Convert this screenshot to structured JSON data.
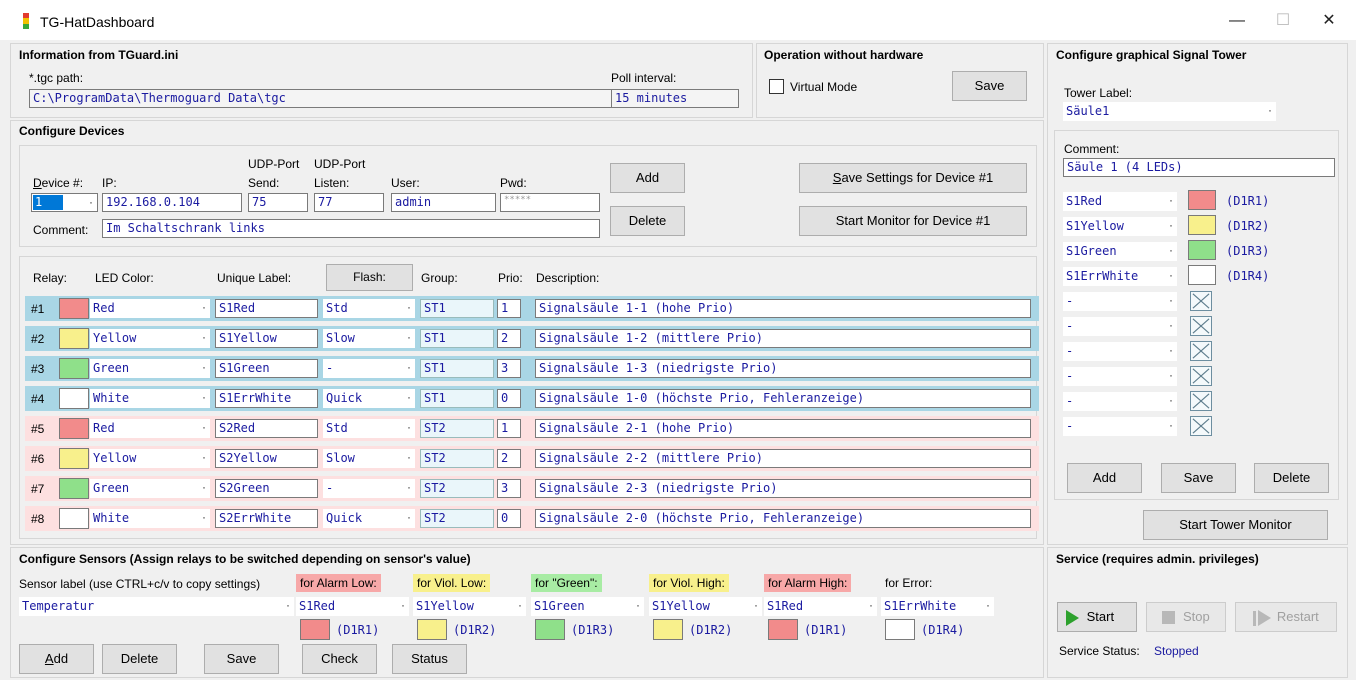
{
  "window": {
    "title": "TG-HatDashboard",
    "minimize": "—",
    "maximize": "☐",
    "close": "✕"
  },
  "info": {
    "title": "Information from TGuard.ini",
    "tgc_label": "*.tgc path:",
    "tgc_value": "C:\\ProgramData\\Thermoguard Data\\tgc",
    "poll_label": "Poll interval:",
    "poll_value": "15 minutes"
  },
  "operation": {
    "title": "Operation without hardware",
    "virtual_label": "Virtual Mode",
    "save": "Save"
  },
  "devices": {
    "title": "Configure Devices",
    "udp_header1": "UDP-Port",
    "udp_header2": "UDP-Port",
    "device_label": "Device #:",
    "device_value": "1",
    "ip_label": "IP:",
    "ip_value": "192.168.0.104",
    "send_label": "Send:",
    "send_value": "75",
    "listen_label": "Listen:",
    "listen_value": "77",
    "user_label": "User:",
    "user_value": "admin",
    "pwd_label": "Pwd:",
    "pwd_value": "*****",
    "comment_label": "Comment:",
    "comment_value": "Im Schaltschrank links",
    "add": "Add",
    "delete": "Delete",
    "save_settings": "Save Settings for Device #1",
    "start_monitor": "Start Monitor for Device #1"
  },
  "relays": {
    "headers": {
      "relay": "Relay:",
      "led": "LED Color:",
      "label": "Unique Label:",
      "flash": "Flash:",
      "group": "Group:",
      "prio": "Prio:",
      "desc": "Description:"
    },
    "rows": [
      {
        "num": "#1",
        "color": "Red",
        "swatch": "#f28b8b",
        "label": "S1Red",
        "flash": "Std",
        "group": "ST1",
        "prio": "1",
        "desc": "Signalsäule 1-1 (hohe Prio)",
        "bg": "#a9d6e5"
      },
      {
        "num": "#2",
        "color": "Yellow",
        "swatch": "#f8f08c",
        "label": "S1Yellow",
        "flash": "Slow",
        "group": "ST1",
        "prio": "2",
        "desc": "Signalsäule 1-2 (mittlere Prio)",
        "bg": "#a9d6e5"
      },
      {
        "num": "#3",
        "color": "Green",
        "swatch": "#8fe08a",
        "label": "S1Green",
        "flash": "-",
        "group": "ST1",
        "prio": "3",
        "desc": "Signalsäule 1-3 (niedrigste Prio)",
        "bg": "#a9d6e5"
      },
      {
        "num": "#4",
        "color": "White",
        "swatch": "#ffffff",
        "label": "S1ErrWhite",
        "flash": "Quick",
        "group": "ST1",
        "prio": "0",
        "desc": "Signalsäule 1-0 (höchste Prio, Fehleranzeige)",
        "bg": "#a9d6e5"
      },
      {
        "num": "#5",
        "color": "Red",
        "swatch": "#f28b8b",
        "label": "S2Red",
        "flash": "Std",
        "group": "ST2",
        "prio": "1",
        "desc": "Signalsäule 2-1 (hohe Prio)",
        "bg": "#fde0e0"
      },
      {
        "num": "#6",
        "color": "Yellow",
        "swatch": "#f8f08c",
        "label": "S2Yellow",
        "flash": "Slow",
        "group": "ST2",
        "prio": "2",
        "desc": "Signalsäule 2-2 (mittlere Prio)",
        "bg": "#fde0e0"
      },
      {
        "num": "#7",
        "color": "Green",
        "swatch": "#8fe08a",
        "label": "S2Green",
        "flash": "-",
        "group": "ST2",
        "prio": "3",
        "desc": "Signalsäule 2-3 (niedrigste Prio)",
        "bg": "#fde0e0"
      },
      {
        "num": "#8",
        "color": "White",
        "swatch": "#ffffff",
        "label": "S2ErrWhite",
        "flash": "Quick",
        "group": "ST2",
        "prio": "0",
        "desc": "Signalsäule 2-0 (höchste Prio, Fehleranzeige)",
        "bg": "#fde0e0"
      }
    ]
  },
  "sensors": {
    "title": "Configure Sensors (Assign relays to be switched depending on sensor's value)",
    "label_header": "Sensor label (use CTRL+c/v to copy settings)",
    "sensor_value": "Temperatur",
    "cols": [
      {
        "header": "for Alarm Low:",
        "bg": "#f7a8a8",
        "value": "S1Red",
        "swatch": "#f28b8b",
        "code": "(D1R1)"
      },
      {
        "header": "for Viol. Low:",
        "bg": "#f8f08c",
        "value": "S1Yellow",
        "swatch": "#f8f08c",
        "code": "(D1R2)"
      },
      {
        "header": "for \"Green\":",
        "bg": "#a8eca4",
        "value": "S1Green",
        "swatch": "#8fe08a",
        "code": "(D1R3)"
      },
      {
        "header": "for Viol. High:",
        "bg": "#f8f08c",
        "value": "S1Yellow",
        "swatch": "#f8f08c",
        "code": "(D1R2)"
      },
      {
        "header": "for Alarm High:",
        "bg": "#f7a8a8",
        "value": "S1Red",
        "swatch": "#f28b8b",
        "code": "(D1R1)"
      },
      {
        "header": "for Error:",
        "bg": "",
        "value": "S1ErrWhite",
        "swatch": "#ffffff",
        "code": "(D1R4)"
      }
    ],
    "buttons": {
      "add": "Add",
      "delete": "Delete",
      "save": "Save",
      "check": "Check",
      "status": "Status"
    }
  },
  "tower": {
    "title": "Configure graphical Signal Tower",
    "label_header": "Tower Label:",
    "label_value": "Säule1",
    "comment_label": "Comment:",
    "comment_value": "Säule 1 (4 LEDs)",
    "slots": [
      {
        "value": "S1Red",
        "swatch": "#f28b8b",
        "code": "(D1R1)"
      },
      {
        "value": "S1Yellow",
        "swatch": "#f8f08c",
        "code": "(D1R2)"
      },
      {
        "value": "S1Green",
        "swatch": "#8fe08a",
        "code": "(D1R3)"
      },
      {
        "value": "S1ErrWhite",
        "swatch": "#ffffff",
        "code": "(D1R4)"
      },
      {
        "value": "-"
      },
      {
        "value": "-"
      },
      {
        "value": "-"
      },
      {
        "value": "-"
      },
      {
        "value": "-"
      },
      {
        "value": "-"
      }
    ],
    "add": "Add",
    "save": "Save",
    "delete": "Delete",
    "start_monitor": "Start Tower Monitor"
  },
  "service": {
    "title": "Service (requires admin. privileges)",
    "start": "Start",
    "stop": "Stop",
    "restart": "Restart",
    "status_label": "Service Status:",
    "status_value": "Stopped"
  }
}
